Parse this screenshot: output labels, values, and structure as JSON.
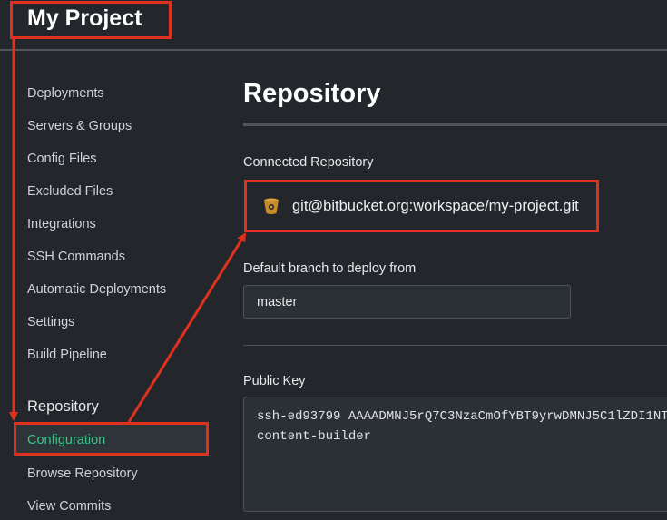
{
  "app": {
    "title": "My Project"
  },
  "sidebar": {
    "items": [
      {
        "label": "Deployments"
      },
      {
        "label": "Servers & Groups"
      },
      {
        "label": "Config Files"
      },
      {
        "label": "Excluded Files"
      },
      {
        "label": "Integrations"
      },
      {
        "label": "SSH Commands"
      },
      {
        "label": "Automatic Deployments"
      },
      {
        "label": "Settings"
      },
      {
        "label": "Build Pipeline"
      }
    ],
    "section_title": "Repository",
    "active_item": "Configuration",
    "sub_items": [
      {
        "label": "Browse Repository"
      },
      {
        "label": "View Commits"
      }
    ]
  },
  "main": {
    "title": "Repository",
    "connected_label": "Connected Repository",
    "repo_url": "git@bitbucket.org:workspace/my-project.git",
    "repo_icon": "bitbucket-icon",
    "branch_label": "Default branch to deploy from",
    "branch_value": "master",
    "public_key_label": "Public Key",
    "public_key": "ssh-ed93799 AAAADMNJ5rQ7C3NzaCmOfYBT9yrwDMNJ5C1lZDI1NT\ncontent-builder"
  },
  "annotation_color": "#e0301e",
  "accent_color": "#3cc48a"
}
